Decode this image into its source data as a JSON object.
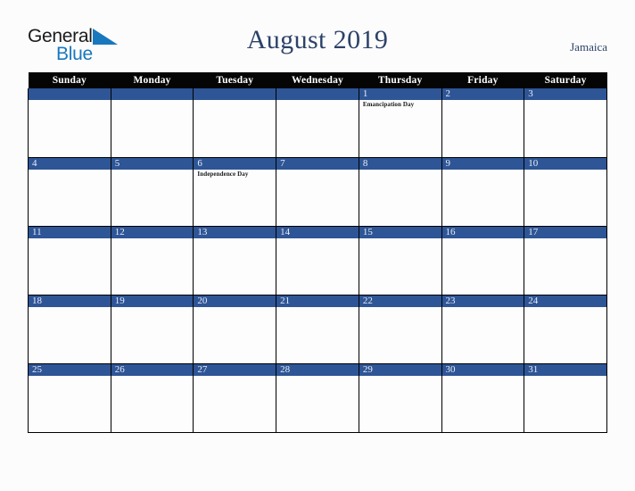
{
  "brand": {
    "name_part1": "General",
    "name_part2": "Blue",
    "triangle_icon": "triangle-icon",
    "colors": {
      "dark": "#1b1b1b",
      "blue": "#1878be"
    }
  },
  "header": {
    "title": "August 2019",
    "region": "Jamaica",
    "title_color": "#2d4269"
  },
  "calendar": {
    "month": "August",
    "year": "2019",
    "weekday_headers": [
      "Sunday",
      "Monday",
      "Tuesday",
      "Wednesday",
      "Thursday",
      "Friday",
      "Saturday"
    ],
    "colors": {
      "header_bg": "#050505",
      "header_text": "#ffffff",
      "daynum_bg": "#2e5596",
      "daynum_text": "#e9eef7",
      "cell_bg": "#fdfdfd",
      "grid_line": "#000000",
      "page_bg": "#fcfcfc"
    },
    "weeks": [
      [
        {
          "day": "",
          "events": []
        },
        {
          "day": "",
          "events": []
        },
        {
          "day": "",
          "events": []
        },
        {
          "day": "",
          "events": []
        },
        {
          "day": "1",
          "events": [
            "Emancipation Day"
          ]
        },
        {
          "day": "2",
          "events": []
        },
        {
          "day": "3",
          "events": []
        }
      ],
      [
        {
          "day": "4",
          "events": []
        },
        {
          "day": "5",
          "events": []
        },
        {
          "day": "6",
          "events": [
            "Independence Day"
          ]
        },
        {
          "day": "7",
          "events": []
        },
        {
          "day": "8",
          "events": []
        },
        {
          "day": "9",
          "events": []
        },
        {
          "day": "10",
          "events": []
        }
      ],
      [
        {
          "day": "11",
          "events": []
        },
        {
          "day": "12",
          "events": []
        },
        {
          "day": "13",
          "events": []
        },
        {
          "day": "14",
          "events": []
        },
        {
          "day": "15",
          "events": []
        },
        {
          "day": "16",
          "events": []
        },
        {
          "day": "17",
          "events": []
        }
      ],
      [
        {
          "day": "18",
          "events": []
        },
        {
          "day": "19",
          "events": []
        },
        {
          "day": "20",
          "events": []
        },
        {
          "day": "21",
          "events": []
        },
        {
          "day": "22",
          "events": []
        },
        {
          "day": "23",
          "events": []
        },
        {
          "day": "24",
          "events": []
        }
      ],
      [
        {
          "day": "25",
          "events": []
        },
        {
          "day": "26",
          "events": []
        },
        {
          "day": "27",
          "events": []
        },
        {
          "day": "28",
          "events": []
        },
        {
          "day": "29",
          "events": []
        },
        {
          "day": "30",
          "events": []
        },
        {
          "day": "31",
          "events": []
        }
      ]
    ]
  }
}
